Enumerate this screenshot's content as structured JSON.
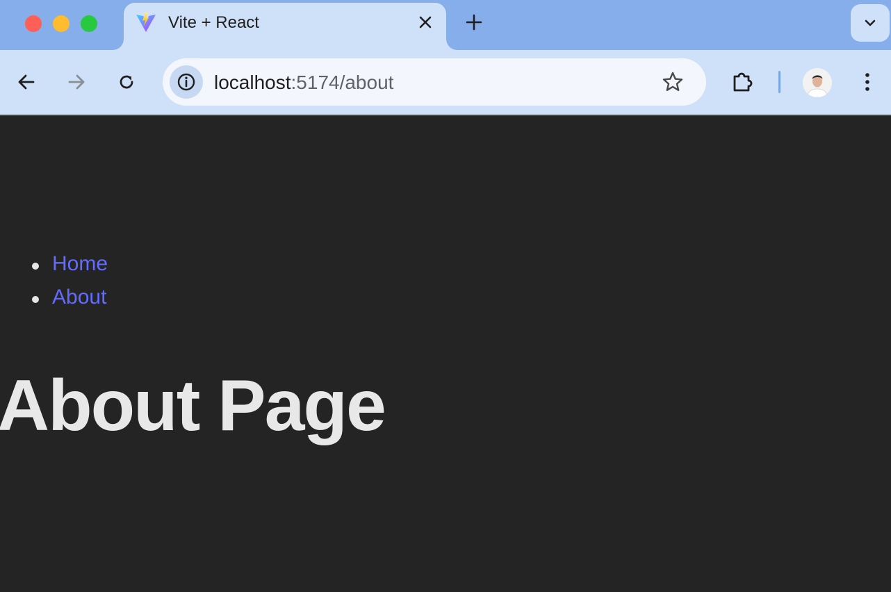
{
  "browser": {
    "tab": {
      "title": "Vite + React",
      "favicon": "vite-logo-icon"
    },
    "address_bar": {
      "host": "localhost",
      "path": ":5174/about"
    },
    "colors": {
      "tabstrip": "#85aeea",
      "toolbar": "#cfe0f9",
      "omnibox": "#f3f7fd"
    }
  },
  "page": {
    "nav": [
      {
        "label": "Home"
      },
      {
        "label": "About"
      }
    ],
    "heading": "About Page",
    "colors": {
      "background": "#242424",
      "link": "#646cff",
      "text": "#e8e8e8"
    }
  }
}
